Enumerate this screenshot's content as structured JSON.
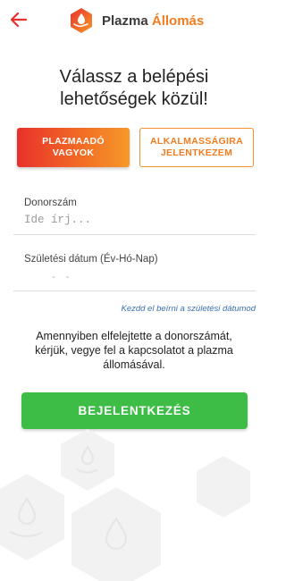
{
  "header": {
    "logo_text_main": "Plazma ",
    "logo_text_accent": "Állomás",
    "back_icon": "arrow-left-icon"
  },
  "title": {
    "line1": "Válassz a belépési",
    "line2": "lehetőségek közül!"
  },
  "options": {
    "primary_line1": "PLAZMAADÓ",
    "primary_line2": "VAGYOK",
    "secondary_line1": "ALKALMASSÁGIRA",
    "secondary_line2": "JELENTKEZEM"
  },
  "form": {
    "donor_label": "Donorszám",
    "donor_placeholder": "Ide írj...",
    "birth_label": "Születési dátum (Év-Hó-Nap)",
    "birth_placeholder": "- -",
    "hint": "Kezdd el beírni a születési dátumod"
  },
  "info": {
    "line1": "Amennyiben elfelejtette a donorszámát,",
    "line2": "kérjük, vegye fel a kapcsolatot a plazma",
    "line3": "állomásával."
  },
  "login": {
    "label": "BEJELENTKEZÉS"
  },
  "colors": {
    "accent_red": "#e8312b",
    "accent_orange": "#f07c1f",
    "login_green": "#3dbd46",
    "link_blue": "#3a6fb0"
  }
}
